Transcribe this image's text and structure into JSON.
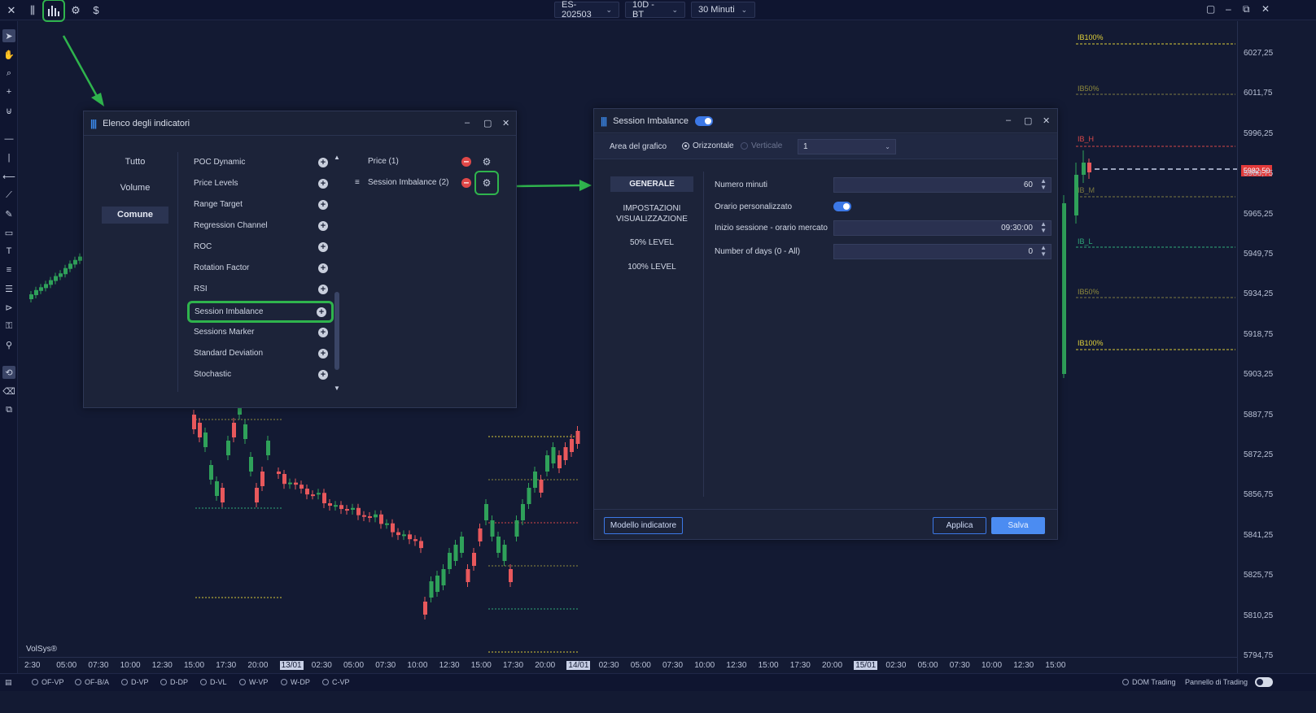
{
  "topbar": {
    "symbol": "ES-202503",
    "range": "10D - BT",
    "timeframe": "30 Minuti"
  },
  "price_axis": {
    "labels": [
      "6027,25",
      "6011,75",
      "5996,25",
      "5980,75",
      "5965,25",
      "5949,75",
      "5934,25",
      "5918,75",
      "5903,25",
      "5887,75",
      "5872,25",
      "5856,75",
      "5841,25",
      "5825,75",
      "5810,25",
      "5794,75"
    ],
    "current_price": "5982,50"
  },
  "time_axis": {
    "labels": [
      "2:30",
      "05:00",
      "07:30",
      "10:00",
      "12:30",
      "15:00",
      "17:30",
      "20:00",
      "13/01",
      "02:30",
      "05:00",
      "07:30",
      "10:00",
      "12:30",
      "15:00",
      "17:30",
      "20:00",
      "14/01",
      "02:30",
      "05:00",
      "07:30",
      "10:00",
      "12:30",
      "15:00",
      "17:30",
      "20:00",
      "15/01",
      "02:30",
      "05:00",
      "07:30",
      "10:00",
      "12:30",
      "15:00"
    ]
  },
  "chart": {
    "brand": "VolSys®",
    "ib_labels": {
      "ib100_top": "IB100%",
      "ib50_top": "IB50%",
      "ib_h": "IB_H",
      "ib_m": "IB_M",
      "ib_l": "IB_L",
      "ib50_bottom": "IB50%",
      "ib100_bottom": "IB100%"
    },
    "colors": {
      "up": "#2fa15a",
      "down": "#e8585c",
      "ib100": "#e0d13a",
      "ib50": "#8f8a3c",
      "ib_h": "#e04a4a",
      "ib_l": "#2faa7a"
    }
  },
  "bottombar": {
    "items": [
      "OF-VP",
      "OF-B/A",
      "D-VP",
      "D-DP",
      "D-VL",
      "W-VP",
      "W-DP",
      "C-VP"
    ],
    "dom_trading": "DOM Trading",
    "trading_panel": "Pannello di Trading"
  },
  "indicator_list": {
    "title": "Elenco degli indicatori",
    "categories": [
      "Tutto",
      "Volume",
      "Comune"
    ],
    "selected_category": "Comune",
    "items": [
      "POC Dynamic",
      "Price Levels",
      "Range Target",
      "Regression Channel",
      "ROC",
      "Rotation Factor",
      "RSI",
      "Session Imbalance",
      "Sessions Marker",
      "Standard Deviation",
      "Stochastic"
    ],
    "highlighted_item": "Session Imbalance",
    "added": [
      "Price (1)",
      "Session Imbalance (2)"
    ]
  },
  "settings": {
    "title": "Session Imbalance",
    "enabled": true,
    "chart_area_label": "Area del grafico",
    "orientation_h": "Orizzontale",
    "orientation_v": "Verticale",
    "area_value": "1",
    "tabs": [
      "GENERALE",
      "IMPOSTAZIONI VISUALIZZAZIONE",
      "50% LEVEL",
      "100% LEVEL"
    ],
    "selected_tab": "GENERALE",
    "fields": [
      {
        "label": "Numero minuti",
        "value": "60"
      },
      {
        "label": "Orario personalizzato",
        "value": "on"
      },
      {
        "label": "Inizio sessione - orario mercato",
        "value": "09:30:00"
      },
      {
        "label": "Number of days (0 - All)",
        "value": "0"
      }
    ],
    "buttons": {
      "template": "Modello indicatore",
      "apply": "Applica",
      "save": "Salva"
    }
  }
}
